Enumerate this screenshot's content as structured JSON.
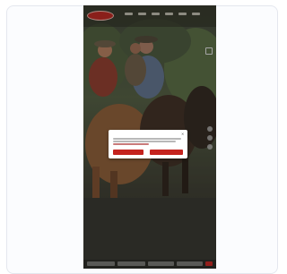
{
  "colors": {
    "brand_red": "#c4231e",
    "page_background": "#ffffff",
    "card_border": "#e4e7ee"
  },
  "site": {
    "logo_icon": "brand-logo-oval",
    "menu_icon": "hamburger-icon"
  },
  "hero": {
    "image_subject": "riders-on-horseback-photo",
    "headline": ""
  },
  "cookie_dialog": {
    "title": "",
    "close_icon": "close-icon",
    "primary_button": "",
    "secondary_button": ""
  }
}
